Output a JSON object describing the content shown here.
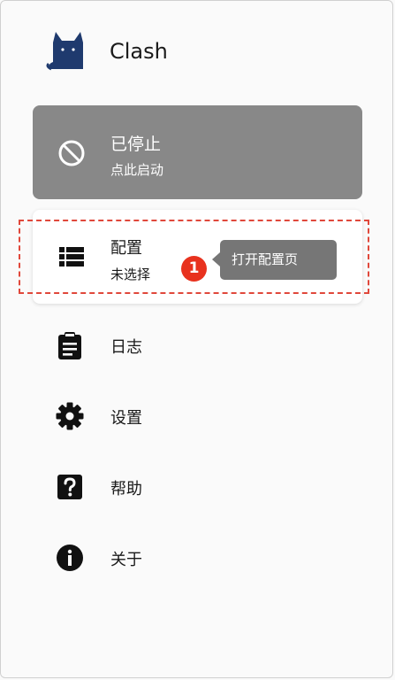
{
  "app": {
    "title": "Clash"
  },
  "status": {
    "title": "已停止",
    "subtitle": "点此启动",
    "icon": "block-icon",
    "bg_color": "#888888"
  },
  "profile": {
    "title": "配置",
    "subtitle": "未选择",
    "icon": "list-icon"
  },
  "annotation": {
    "step": "1",
    "tooltip": "打开配置页",
    "highlight_color": "#e0483b",
    "badge_color": "#e8321e"
  },
  "nav": {
    "items": [
      {
        "label": "日志",
        "icon": "clipboard-icon"
      },
      {
        "label": "设置",
        "icon": "gear-icon"
      },
      {
        "label": "帮助",
        "icon": "help-icon"
      },
      {
        "label": "关于",
        "icon": "info-icon"
      }
    ]
  }
}
